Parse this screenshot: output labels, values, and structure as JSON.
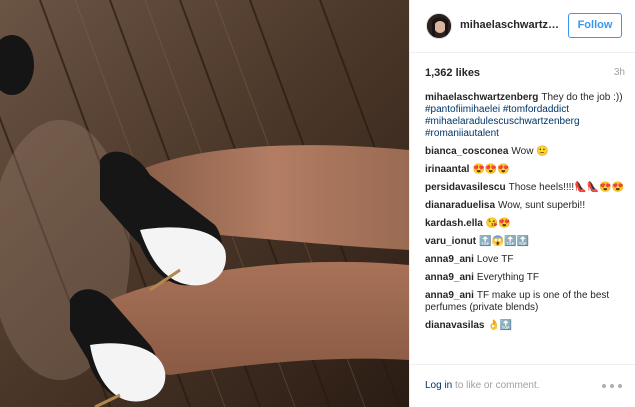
{
  "post": {
    "username": "mihaelaschwartzen...",
    "follow_label": "Follow",
    "likes": "1,362 likes",
    "time": "3h"
  },
  "caption": {
    "user": "mihaelaschwartzenberg",
    "text": "They do the job :))",
    "tags": "#pantofiimihaelei #tomfordaddict #mihaelaradulescuschwartzenberg #romaniiautalent"
  },
  "comments": [
    {
      "user": "bianca_cosconea",
      "text": "Wow 🙂"
    },
    {
      "user": "irinaantal",
      "text": "😍😍😍"
    },
    {
      "user": "persidavasilescu",
      "text": "Those heels!!!!👠👠😍😍"
    },
    {
      "user": "dianaraduelisa",
      "text": "Wow, sunt superbi!!"
    },
    {
      "user": "kardash.ella",
      "text": "😘😍"
    },
    {
      "user": "varu_ionut",
      "text": "🔝😱🔝🔝"
    },
    {
      "user": "anna9_ani",
      "text": "Love TF"
    },
    {
      "user": "anna9_ani",
      "text": "Everything TF"
    },
    {
      "user": "anna9_ani",
      "text": "TF make up is one of the best perfumes (private blends)"
    },
    {
      "user": "dianavasilas",
      "text": "👌🔝"
    }
  ],
  "footer": {
    "login_link": "Log in",
    "login_rest": " to like or comment."
  },
  "icons": {
    "more": "more-options-icon",
    "avatar": "profile-avatar"
  },
  "colors": {
    "follow_blue": "#3897f0",
    "link_blue": "#003569",
    "muted_gray": "#a0a0a0"
  }
}
